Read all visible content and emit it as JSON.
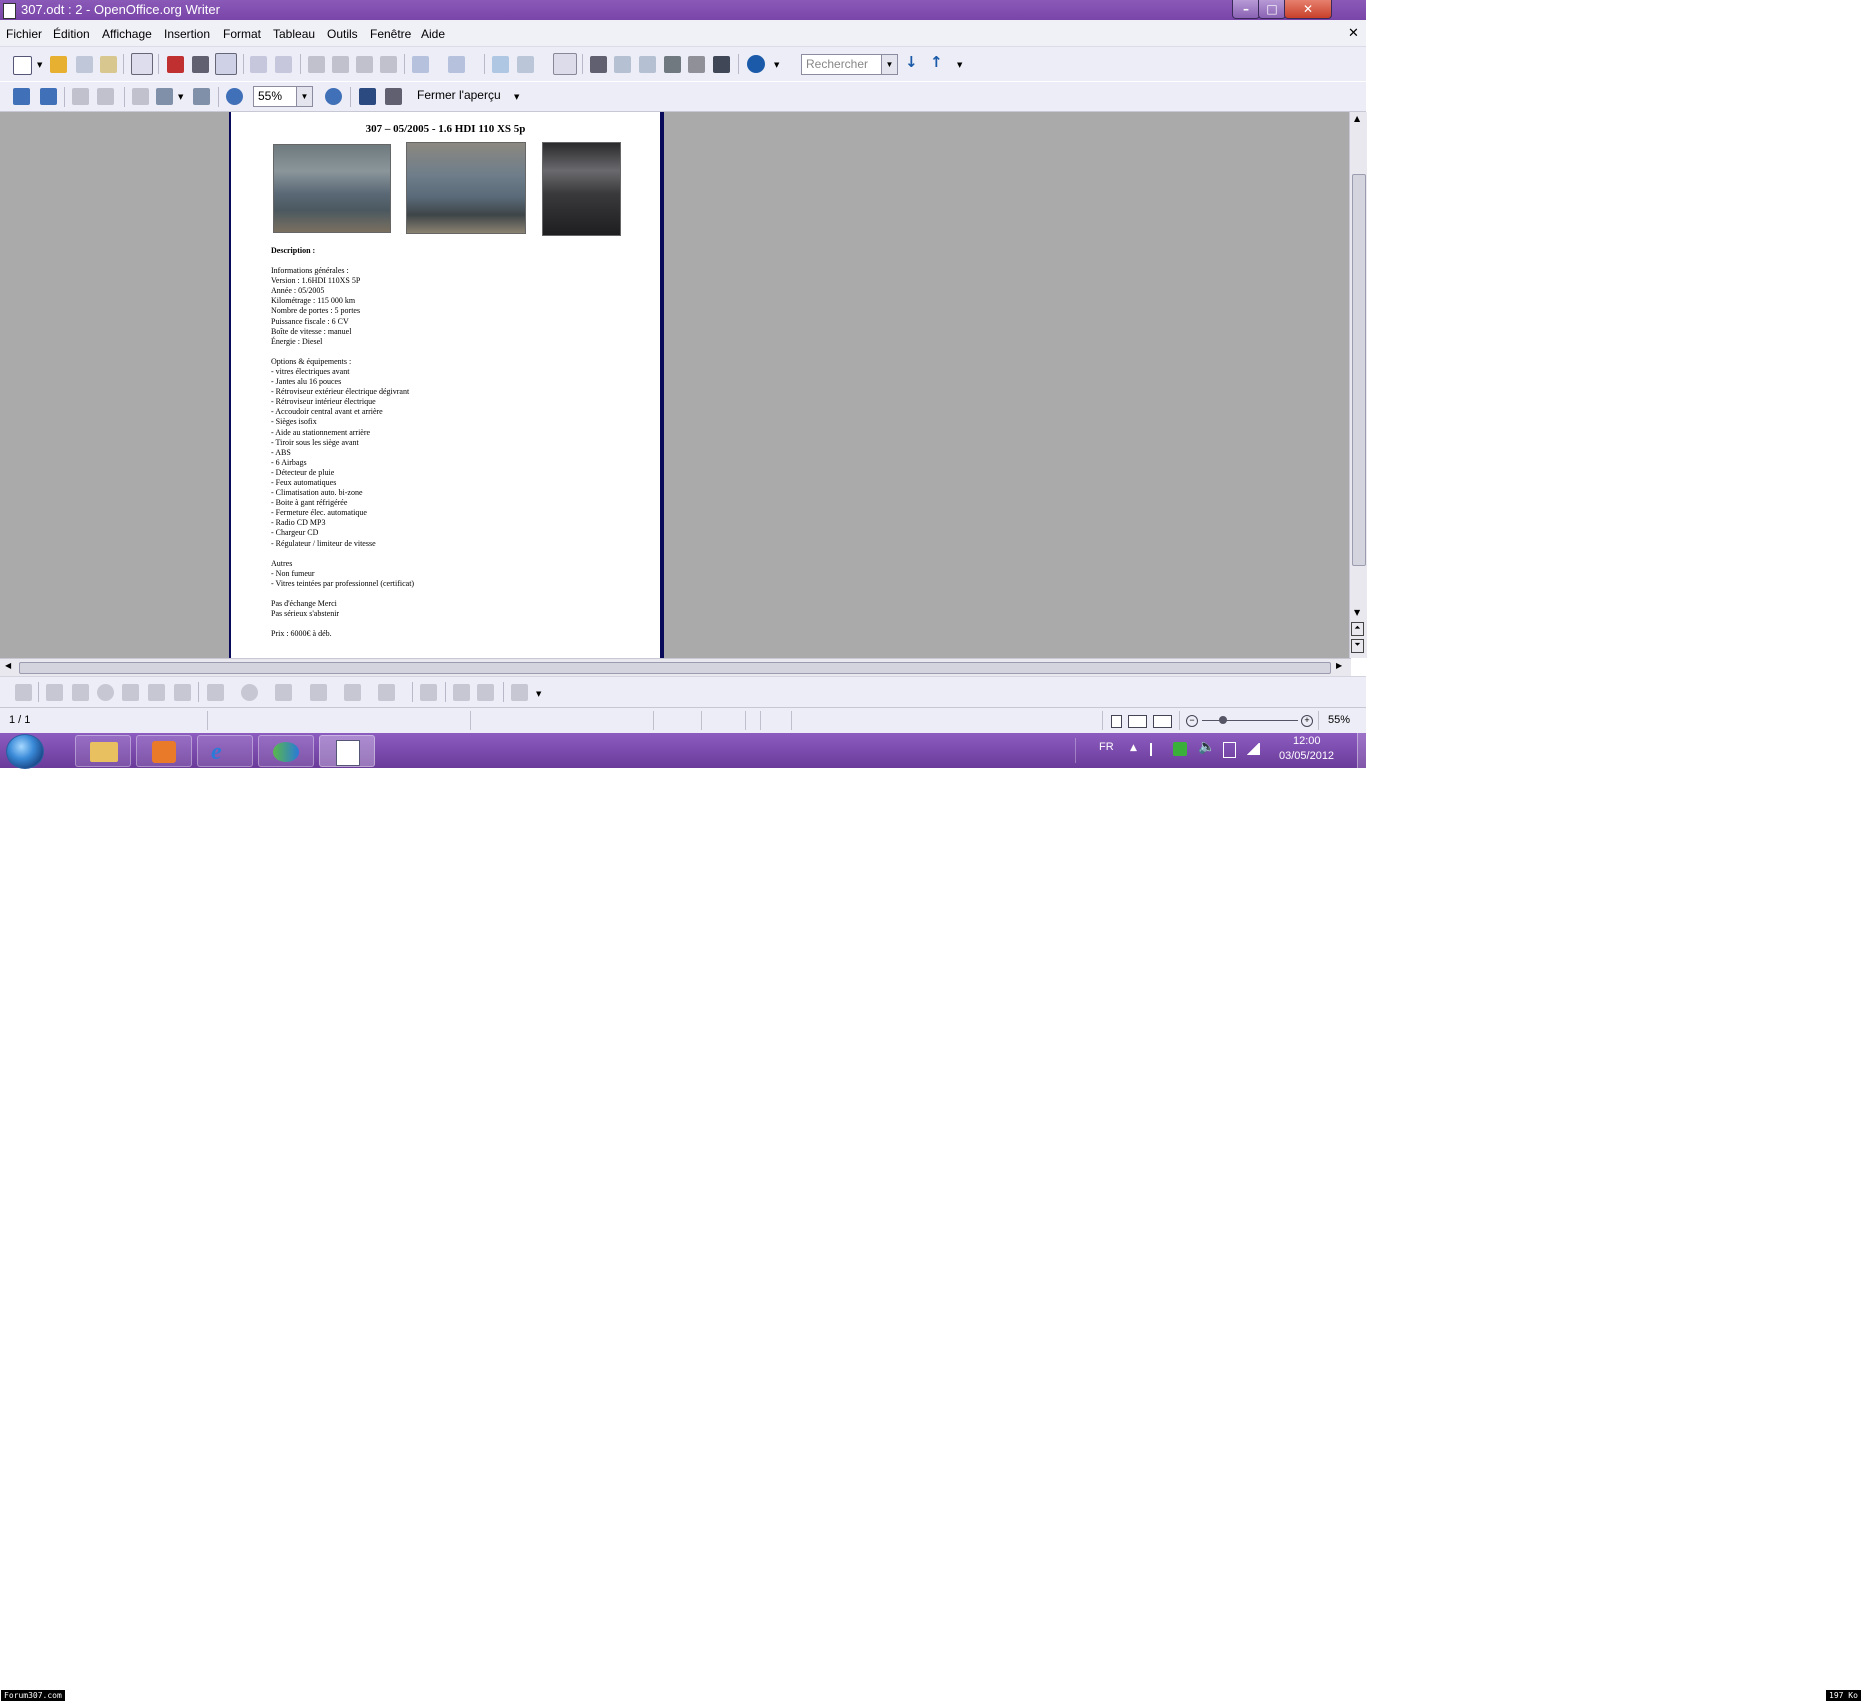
{
  "window": {
    "title": "307.odt : 2 - OpenOffice.org Writer",
    "controls": {
      "minimize": "–",
      "maximize": "□",
      "close": "✕"
    }
  },
  "menu": {
    "items": [
      "Fichier",
      "Édition",
      "Affichage",
      "Insertion",
      "Format",
      "Tableau",
      "Outils",
      "Fenêtre",
      "Aide"
    ],
    "close_doc": "✕"
  },
  "toolbar": {
    "search_placeholder": "Rechercher",
    "zoom_value": "55%",
    "close_preview_label": "Fermer l'aperçu"
  },
  "document": {
    "title": "307 – 05/2005 - 1.6 HDI 110 XS 5p",
    "photos": [
      "car-front-photo",
      "car-rear-photo",
      "car-dashboard-photo"
    ],
    "description_heading": "Description :",
    "lines": [
      "",
      "Informations générales :",
      "Version : 1.6HDI 110XS 5P",
      "Année : 05/2005",
      "Kilométrage : 115 000 km",
      "Nombre de portes : 5 portes",
      "Puissance fiscale : 6 CV",
      "Boîte de vitesse : manuel",
      "Énergie : Diesel",
      "",
      "Options & équipements :",
      "- vitres électriques avant",
      "- Jantes alu 16 pouces",
      "- Rétroviseur extérieur électrique dégivrant",
      "- Rétroviseur intérieur électrique",
      "- Accoudoir central avant et arrière",
      "- Sièges isofix",
      "- Aide au stationnement arrière",
      "-  Tiroir sous les siège avant",
      "- ABS",
      "- 6 Airbags",
      "- Détecteur de pluie",
      "- Feux automatiques",
      "- Climatisation auto. bi-zone",
      "- Boite à gant réfrigérée",
      "- Fermeture élec. automatique",
      "- Radio CD MP3",
      "- Chargeur CD",
      "- Régulateur / limiteur de vitesse",
      "",
      "Autres",
      "- Non fumeur",
      "- Vitres teintées par professionnel (certificat)",
      "",
      "Pas d'échange Merci",
      "Pas sérieux s'abstenir",
      "",
      "Prix : 6000€ à déb."
    ]
  },
  "status": {
    "page": "1 / 1",
    "zoom": "55%"
  },
  "taskbar": {
    "language": "FR",
    "time": "12:00",
    "date": "03/05/2012",
    "apps": [
      "explorer",
      "media-player",
      "internet-explorer",
      "messenger",
      "openoffice-writer"
    ]
  },
  "watermark": {
    "left": "Forum307.com",
    "right": "197 Ko"
  },
  "colors": {
    "titlebar": "#7a45a8",
    "taskbar": "#6b3b9a",
    "page_border": "#0a0a5a",
    "workspace": "#aaaaaa"
  }
}
